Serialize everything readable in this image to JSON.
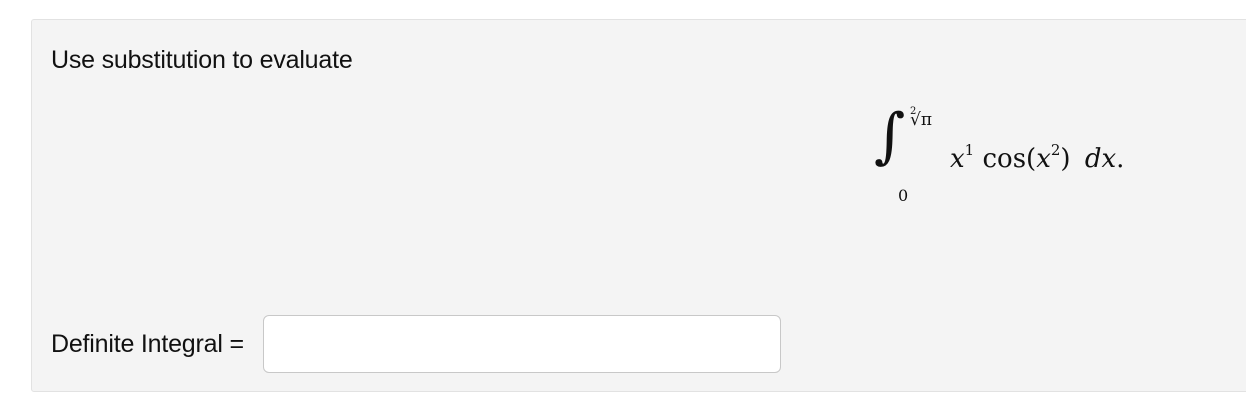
{
  "question": {
    "prompt": "Use substitution to evaluate",
    "integral": {
      "sign": "∫",
      "lower_limit": "0",
      "upper_limit_index": "2",
      "upper_limit_radical": "√π",
      "integrand_var": "x",
      "integrand_exp": "1",
      "integrand_func": "cos",
      "inner_open": "(",
      "inner_var": "x",
      "inner_exp": "2",
      "inner_close": ")",
      "differential": "dx",
      "terminator": "."
    }
  },
  "answer": {
    "label": "Definite Integral =",
    "value": "",
    "placeholder": ""
  }
}
